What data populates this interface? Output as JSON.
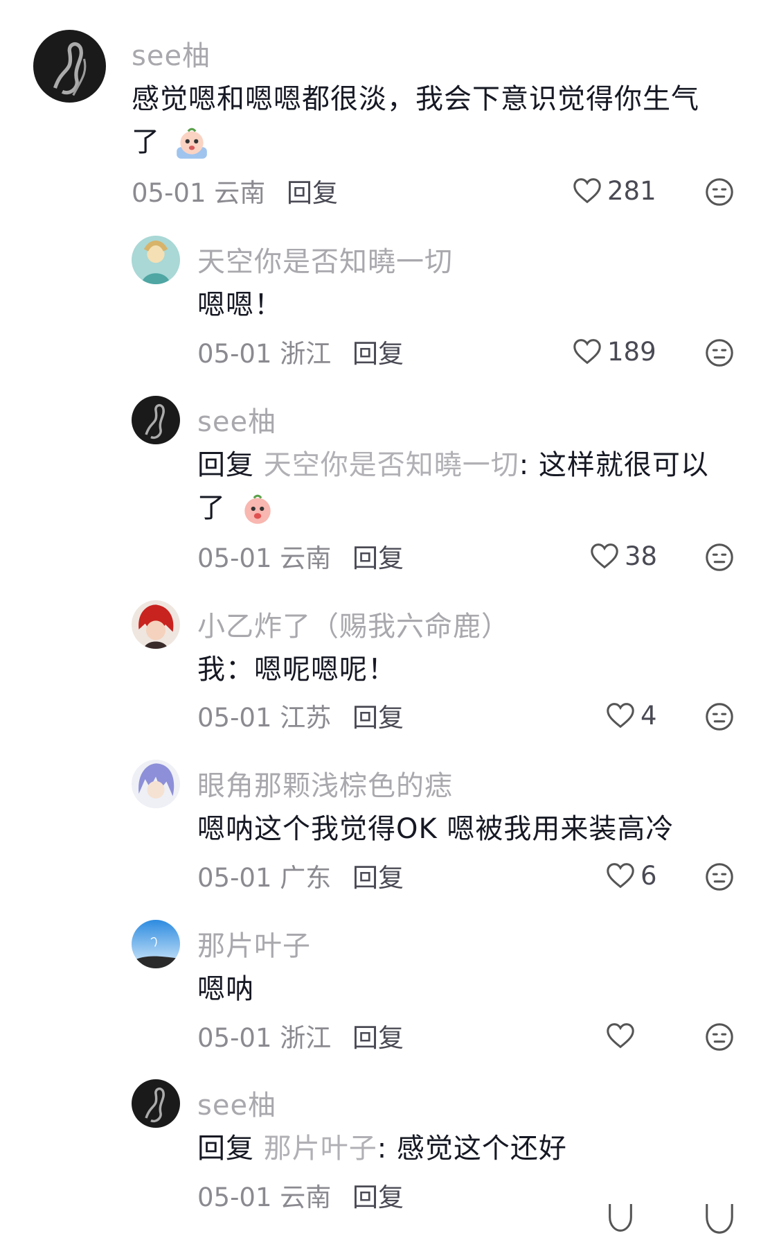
{
  "comments": [
    {
      "user": "see柚",
      "text": "感觉嗯和嗯嗯都很淡，我会下意识觉得你生气",
      "text2": "了",
      "emoji": "crying-peach-emoji",
      "date": "05-01 云南",
      "reply_label": "回复",
      "likes": "281"
    },
    {
      "user": "天空你是否知曉一切",
      "text": "嗯嗯！",
      "date": "05-01 浙江",
      "reply_label": "回复",
      "likes": "189"
    },
    {
      "user": "see柚",
      "reply_prefix": "回复",
      "reply_to": "天空你是否知曉一切",
      "text": ": 这样就很可以",
      "text2": "了",
      "emoji": "shy-peach-emoji",
      "date": "05-01 云南",
      "reply_label": "回复",
      "likes": "38"
    },
    {
      "user": "小乙炸了（赐我六命鹿）",
      "text": "我：嗯呢嗯呢！",
      "date": "05-01 江苏",
      "reply_label": "回复",
      "likes": "4"
    },
    {
      "user": "眼角那颗浅棕色的痣",
      "text": "嗯呐这个我觉得OK 嗯被我用来装高冷",
      "date": "05-01 广东",
      "reply_label": "回复",
      "likes": "6"
    },
    {
      "user": "那片叶子",
      "text": "嗯呐",
      "date": "05-01 浙江",
      "reply_label": "回复",
      "likes": ""
    },
    {
      "user": "see柚",
      "reply_prefix": "回复",
      "reply_to": "那片叶子",
      "text": ": 感觉这个还好",
      "date": "05-01 云南",
      "reply_label": "回复"
    }
  ]
}
